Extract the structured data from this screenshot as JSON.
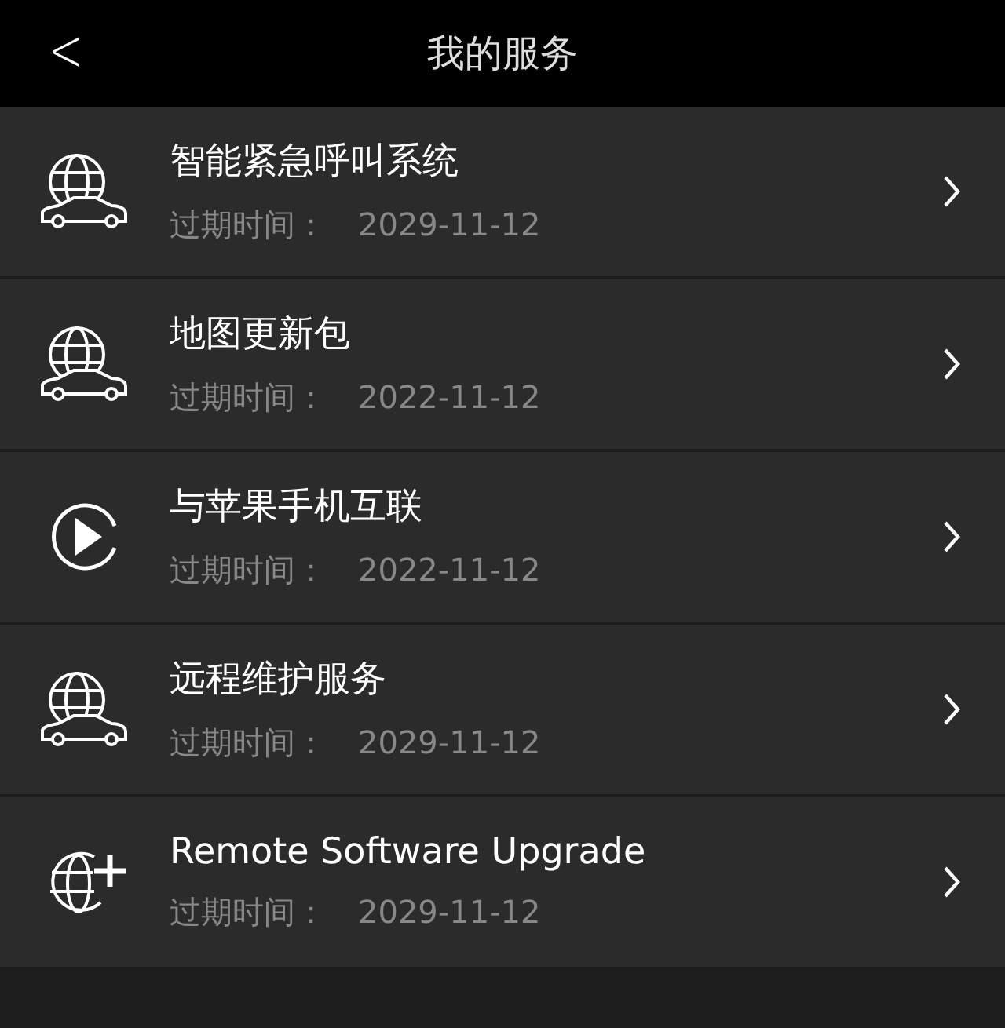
{
  "header": {
    "back": "<",
    "title": "我的服务"
  },
  "services": [
    {
      "kind": "globe-car",
      "name": "智能紧急呼叫系统",
      "expiry_label": "过期时间：",
      "expiry_date": "2029-11-12"
    },
    {
      "kind": "globe-car",
      "name": "地图更新包",
      "expiry_label": "过期时间：",
      "expiry_date": "2022-11-12"
    },
    {
      "kind": "play",
      "name": "与苹果手机互联",
      "expiry_label": "过期时间：",
      "expiry_date": "2022-11-12"
    },
    {
      "kind": "globe-car",
      "name": "远程维护服务",
      "expiry_label": "过期时间：",
      "expiry_date": "2029-11-12"
    },
    {
      "kind": "globe-plus",
      "name": "Remote Software Upgrade",
      "expiry_label": "过期时间：",
      "expiry_date": "2029-11-12"
    }
  ]
}
